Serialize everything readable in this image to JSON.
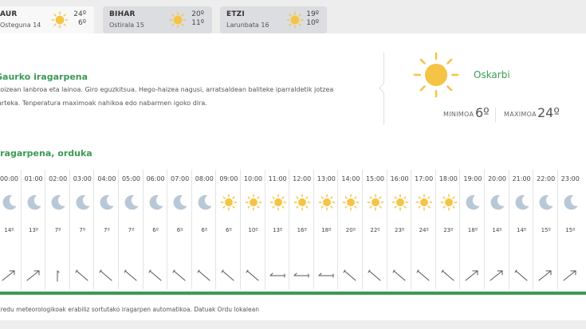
{
  "days": [
    {
      "name": "AUR",
      "date": "Osteguna 14",
      "max": "24º",
      "min": "6º",
      "active": true
    },
    {
      "name": "BIHAR",
      "date": "Ostirala 15",
      "max": "20º",
      "min": "11º",
      "active": false
    },
    {
      "name": "ETZI",
      "date": "Larunbata 16",
      "max": "19º",
      "min": "10º",
      "active": false
    }
  ],
  "forecast": {
    "title": "Gaurko iragarpena",
    "description": "Goizean lanbroa eta lainoa. Giro eguzkitsua. Hego-haizea nagusi, arratsaldean baliteke iparraldetik jotzea tarteka. Tenperatura maximoak nahikoa edo nabarmen igoko dira.",
    "condition": "Oskarbi",
    "min_label": "MINIMOA",
    "min_value": "6º",
    "max_label": "MAXIMOA",
    "max_value": "24º",
    "icon": "sun-icon"
  },
  "hourly": {
    "title": "Iragarpena, orduka",
    "items": [
      {
        "time": "00:00",
        "icon": "moon",
        "temp": "14º",
        "wind": "ne"
      },
      {
        "time": "01:00",
        "icon": "moon",
        "temp": "13º",
        "wind": "ne"
      },
      {
        "time": "02:00",
        "icon": "moon",
        "temp": "7º",
        "wind": "n"
      },
      {
        "time": "03:00",
        "icon": "moon",
        "temp": "7º",
        "wind": "se"
      },
      {
        "time": "04:00",
        "icon": "moon",
        "temp": "7º",
        "wind": "se"
      },
      {
        "time": "05:00",
        "icon": "moon",
        "temp": "7º",
        "wind": "se"
      },
      {
        "time": "06:00",
        "icon": "moon",
        "temp": "6º",
        "wind": "se"
      },
      {
        "time": "07:00",
        "icon": "moon",
        "temp": "6º",
        "wind": "se"
      },
      {
        "time": "08:00",
        "icon": "moon",
        "temp": "6º",
        "wind": "se"
      },
      {
        "time": "09:00",
        "icon": "sun",
        "temp": "6º",
        "wind": "se"
      },
      {
        "time": "10:00",
        "icon": "sun",
        "temp": "10º",
        "wind": "se"
      },
      {
        "time": "11:00",
        "icon": "sun",
        "temp": "13º",
        "wind": "w"
      },
      {
        "time": "12:00",
        "icon": "sun",
        "temp": "16º",
        "wind": "w"
      },
      {
        "time": "13:00",
        "icon": "sun",
        "temp": "18º",
        "wind": "w"
      },
      {
        "time": "14:00",
        "icon": "sun",
        "temp": "20º",
        "wind": "se"
      },
      {
        "time": "15:00",
        "icon": "sun",
        "temp": "22º",
        "wind": "se"
      },
      {
        "time": "16:00",
        "icon": "sun",
        "temp": "23º",
        "wind": "se"
      },
      {
        "time": "17:00",
        "icon": "sun",
        "temp": "24º",
        "wind": "se"
      },
      {
        "time": "18:00",
        "icon": "sun",
        "temp": "23º",
        "wind": "se"
      },
      {
        "time": "19:00",
        "icon": "moon",
        "temp": "18º",
        "wind": "ne"
      },
      {
        "time": "20:00",
        "icon": "moon",
        "temp": "14º",
        "wind": "ne"
      },
      {
        "time": "21:00",
        "icon": "moon",
        "temp": "14º",
        "wind": "se"
      },
      {
        "time": "22:00",
        "icon": "moon",
        "temp": "15º",
        "wind": "ne"
      },
      {
        "time": "23:00",
        "icon": "moon",
        "temp": "15º",
        "wind": "ne"
      }
    ]
  },
  "footer": "Eredu meteorologikoak erabiliz sortutako iragarpen automatikoa. Datuak Ordu lokalean",
  "colors": {
    "accent": "#3a9a53",
    "sun": "#f5c444",
    "moon": "#b9c8d6"
  }
}
